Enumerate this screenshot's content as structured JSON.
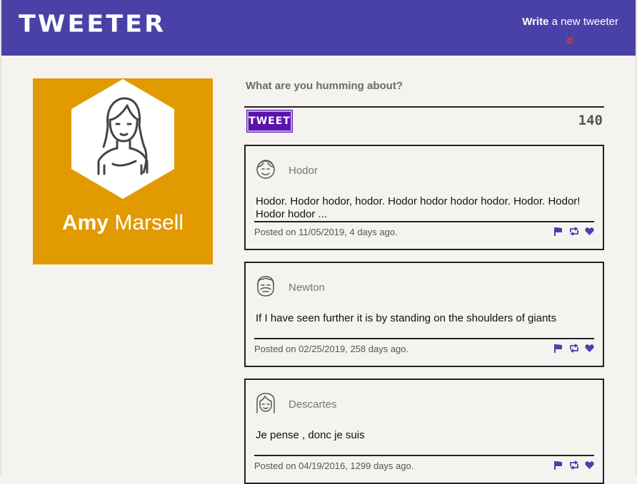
{
  "header": {
    "brand": "TWEETER",
    "compose_bold": "Write",
    "compose_rest": " a new tweeter",
    "chevron": "»",
    "accent": "#4a41a8"
  },
  "profile": {
    "first_name": "Amy",
    "last_name": " Marsell",
    "card_color": "#e19a00",
    "avatar_icon": "girl-avatar-icon"
  },
  "composer": {
    "prompt": "What are you humming about?",
    "button_label": "TWEET",
    "counter": "140"
  },
  "tweets": [
    {
      "author": "Hodor",
      "avatar_icon": "smiling-man-avatar-icon",
      "text": "Hodor. Hodor hodor, hodor. Hodor hodor hodor hodor. Hodor. Hodor! Hodor hodor ...",
      "date": "Posted on 11/05/2019, 4 days ago."
    },
    {
      "author": "Newton",
      "avatar_icon": "bearded-man-avatar-icon",
      "text": "If I have seen further it is by standing on the shoulders of giants",
      "date": "Posted on 02/25/2019, 258 days ago."
    },
    {
      "author": "Descartes",
      "avatar_icon": "long-hair-avatar-icon",
      "text": "Je pense , donc je suis",
      "date": "Posted on 04/19/2016, 1299 days ago."
    }
  ],
  "action_icons": [
    "flag-icon",
    "retweet-icon",
    "heart-icon"
  ],
  "action_color": "#4a41a8"
}
